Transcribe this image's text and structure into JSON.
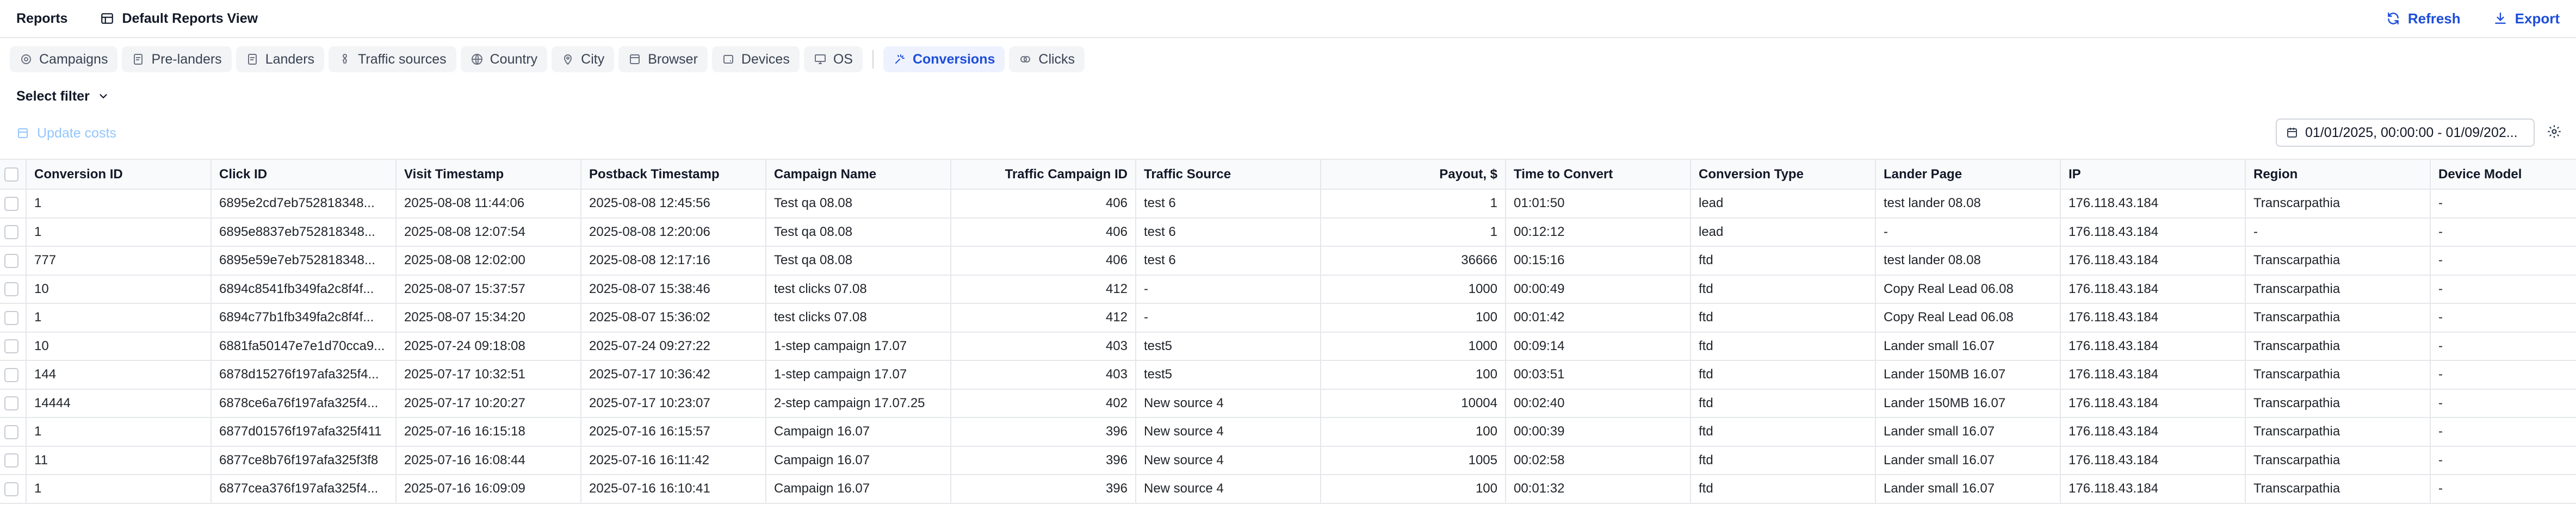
{
  "header": {
    "title": "Reports",
    "view_name": "Default Reports View",
    "refresh_label": "Refresh",
    "export_label": "Export"
  },
  "colors": {
    "accent": "#1d4ed8",
    "active_tab_bg": "#eef2ff",
    "disabled_link": "#93c5fd"
  },
  "tabs": [
    {
      "label": "Campaigns",
      "icon": "target-icon"
    },
    {
      "label": "Pre-landers",
      "icon": "page-icon"
    },
    {
      "label": "Landers",
      "icon": "page-icon"
    },
    {
      "label": "Traffic sources",
      "icon": "person-icon"
    },
    {
      "label": "Country",
      "icon": "globe-icon"
    },
    {
      "label": "City",
      "icon": "pin-icon"
    },
    {
      "label": "Browser",
      "icon": "browser-icon"
    },
    {
      "label": "Devices",
      "icon": "tablet-icon"
    },
    {
      "label": "OS",
      "icon": "monitor-icon"
    },
    {
      "label": "Conversions",
      "icon": "sparkle-icon",
      "active": true
    },
    {
      "label": "Clicks",
      "icon": "clicks-icon"
    }
  ],
  "filter": {
    "label": "Select filter"
  },
  "actions": {
    "update_costs_label": "Update costs"
  },
  "date_range": {
    "value": "01/01/2025, 00:00:00 - 01/09/202..."
  },
  "table": {
    "columns": [
      "Conversion ID",
      "Click ID",
      "Visit Timestamp",
      "Postback Timestamp",
      "Campaign Name",
      "Traffic Campaign ID",
      "Traffic Source",
      "Payout, $",
      "Time to Convert",
      "Conversion Type",
      "Lander Page",
      "IP",
      "Region",
      "Device Model"
    ],
    "rows": [
      [
        "1",
        "6895e2cd7eb752818348...",
        "2025-08-08 11:44:06",
        "2025-08-08 12:45:56",
        "Test qa 08.08",
        "406",
        "test 6",
        "1",
        "01:01:50",
        "lead",
        "test lander 08.08",
        "176.118.43.184",
        "Transcarpathia",
        "-"
      ],
      [
        "1",
        "6895e8837eb752818348...",
        "2025-08-08 12:07:54",
        "2025-08-08 12:20:06",
        "Test qa 08.08",
        "406",
        "test 6",
        "1",
        "00:12:12",
        "lead",
        "-",
        "176.118.43.184",
        "-",
        "-"
      ],
      [
        "777",
        "6895e59e7eb752818348...",
        "2025-08-08 12:02:00",
        "2025-08-08 12:17:16",
        "Test qa 08.08",
        "406",
        "test 6",
        "36666",
        "00:15:16",
        "ftd",
        "test lander 08.08",
        "176.118.43.184",
        "Transcarpathia",
        "-"
      ],
      [
        "10",
        "6894c8541fb349fa2c8f4f...",
        "2025-08-07 15:37:57",
        "2025-08-07 15:38:46",
        "test clicks 07.08",
        "412",
        "-",
        "1000",
        "00:00:49",
        "ftd",
        "Copy Real Lead 06.08",
        "176.118.43.184",
        "Transcarpathia",
        "-"
      ],
      [
        "1",
        "6894c77b1fb349fa2c8f4f...",
        "2025-08-07 15:34:20",
        "2025-08-07 15:36:02",
        "test clicks 07.08",
        "412",
        "-",
        "100",
        "00:01:42",
        "ftd",
        "Copy Real Lead 06.08",
        "176.118.43.184",
        "Transcarpathia",
        "-"
      ],
      [
        "10",
        "6881fa50147e7e1d70cca9...",
        "2025-07-24 09:18:08",
        "2025-07-24 09:27:22",
        "1-step campaign 17.07",
        "403",
        "test5",
        "1000",
        "00:09:14",
        "ftd",
        "Lander small 16.07",
        "176.118.43.184",
        "Transcarpathia",
        "-"
      ],
      [
        "144",
        "6878d15276f197afa325f4...",
        "2025-07-17 10:32:51",
        "2025-07-17 10:36:42",
        "1-step campaign 17.07",
        "403",
        "test5",
        "100",
        "00:03:51",
        "ftd",
        "Lander 150MB 16.07",
        "176.118.43.184",
        "Transcarpathia",
        "-"
      ],
      [
        "14444",
        "6878ce6a76f197afa325f4...",
        "2025-07-17 10:20:27",
        "2025-07-17 10:23:07",
        "2-step campaign 17.07.25",
        "402",
        "New source 4",
        "10004",
        "00:02:40",
        "ftd",
        "Lander 150MB 16.07",
        "176.118.43.184",
        "Transcarpathia",
        "-"
      ],
      [
        "1",
        "6877d01576f197afa325f411",
        "2025-07-16 16:15:18",
        "2025-07-16 16:15:57",
        "Campaign 16.07",
        "396",
        "New source 4",
        "100",
        "00:00:39",
        "ftd",
        "Lander small 16.07",
        "176.118.43.184",
        "Transcarpathia",
        "-"
      ],
      [
        "11",
        "6877ce8b76f197afa325f3f8",
        "2025-07-16 16:08:44",
        "2025-07-16 16:11:42",
        "Campaign 16.07",
        "396",
        "New source 4",
        "1005",
        "00:02:58",
        "ftd",
        "Lander small 16.07",
        "176.118.43.184",
        "Transcarpathia",
        "-"
      ],
      [
        "1",
        "6877cea376f197afa325f4...",
        "2025-07-16 16:09:09",
        "2025-07-16 16:10:41",
        "Campaign 16.07",
        "396",
        "New source 4",
        "100",
        "00:01:32",
        "ftd",
        "Lander small 16.07",
        "176.118.43.184",
        "Transcarpathia",
        "-"
      ]
    ]
  }
}
